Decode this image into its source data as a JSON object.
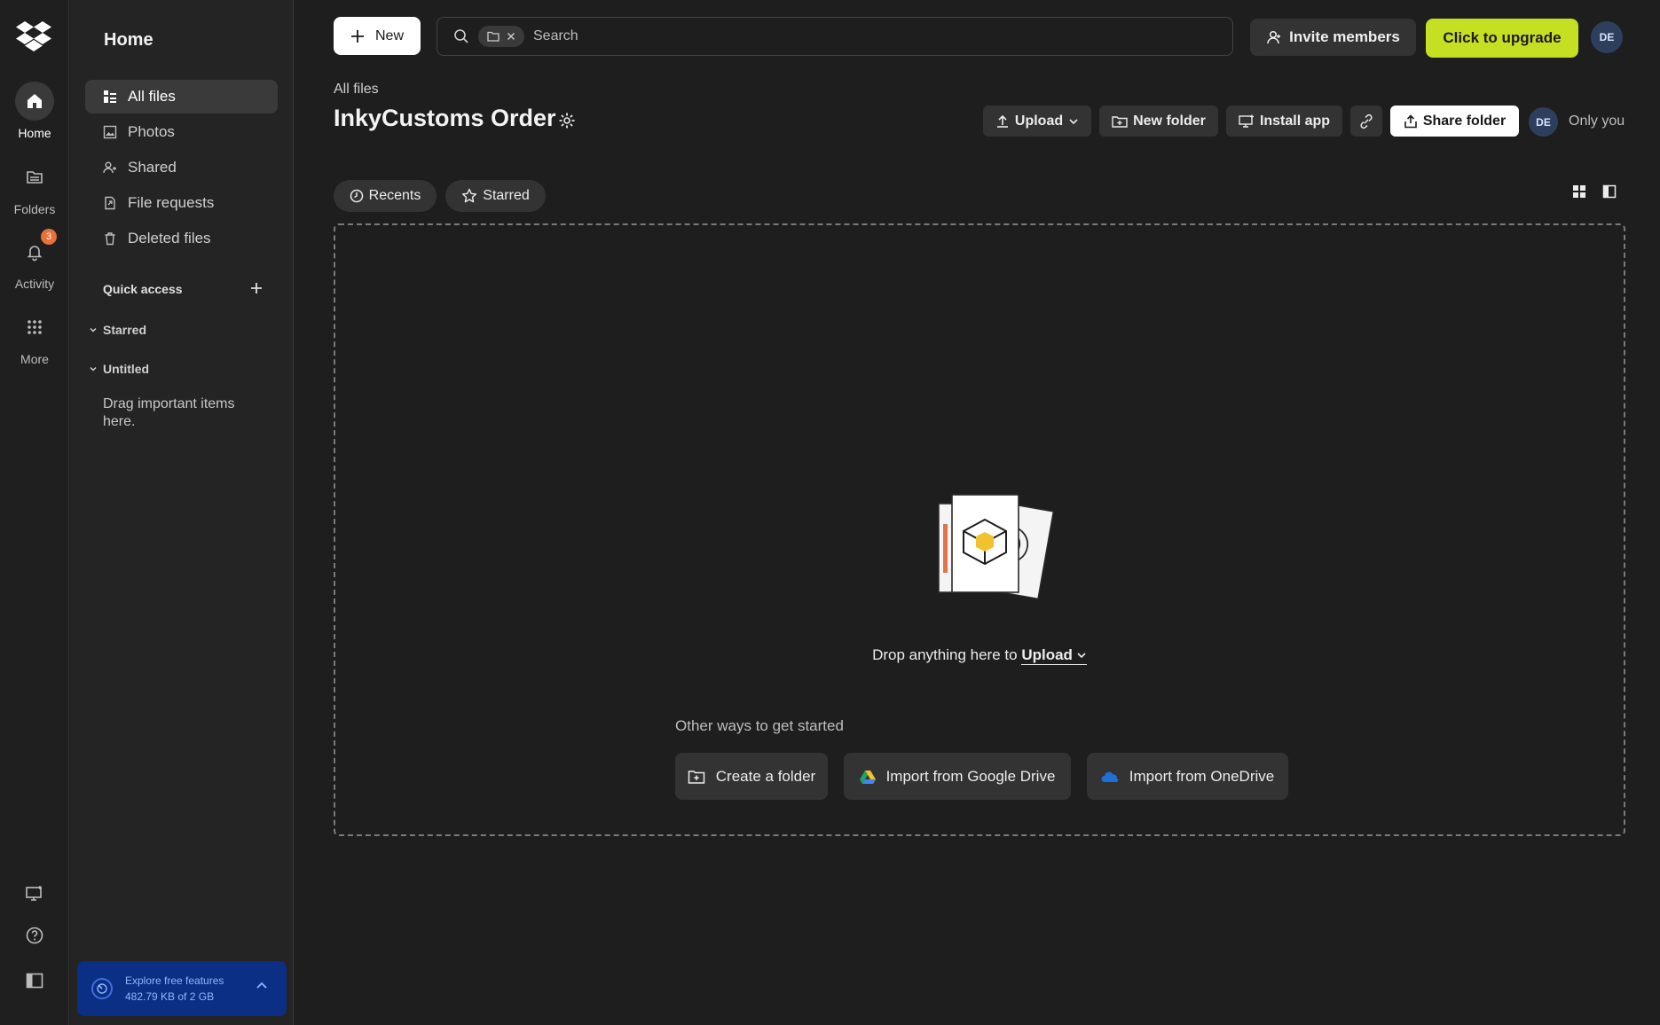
{
  "rail": {
    "items": [
      {
        "label": "Home",
        "icon": "home-icon"
      },
      {
        "label": "Folders",
        "icon": "folder-icon"
      },
      {
        "label": "Activity",
        "icon": "bell-icon",
        "badge": "3"
      },
      {
        "label": "More",
        "icon": "grid-icon"
      }
    ],
    "bottom_icons": [
      "desktop-icon",
      "help-icon",
      "sidebar-toggle-icon"
    ]
  },
  "panel": {
    "title": "Home",
    "nav": [
      {
        "label": "All files",
        "icon": "files-icon"
      },
      {
        "label": "Photos",
        "icon": "photo-icon"
      },
      {
        "label": "Shared",
        "icon": "shared-icon"
      },
      {
        "label": "File requests",
        "icon": "file-request-icon"
      },
      {
        "label": "Deleted files",
        "icon": "trash-icon"
      }
    ],
    "quick_access": "Quick access",
    "groups": [
      "Starred",
      "Untitled"
    ],
    "drag_hint": "Drag important items here.",
    "explore": {
      "title": "Explore free features",
      "usage": "482.79 KB of 2 GB"
    }
  },
  "topbar": {
    "new_label": "New",
    "search_placeholder": "Search",
    "invite_label": "Invite members",
    "upgrade_label": "Click to upgrade",
    "avatar": "DE"
  },
  "header": {
    "breadcrumb": "All files",
    "title": "InkyCustoms Order",
    "upload": "Upload",
    "new_folder": "New folder",
    "install_app": "Install app",
    "share_folder": "Share folder",
    "avatar": "DE",
    "sharing": "Only you"
  },
  "filters": {
    "recents": "Recents",
    "starred": "Starred"
  },
  "dropzone": {
    "text_prefix": "Drop anything here to",
    "upload": "Upload",
    "other_ways": "Other ways to get started",
    "create_folder": "Create a folder",
    "google_drive": "Import from Google Drive",
    "onedrive": "Import from OneDrive"
  },
  "colors": {
    "accent": "#c5e023",
    "explore_bg": "#0b2f84",
    "badge": "#e8703a"
  }
}
